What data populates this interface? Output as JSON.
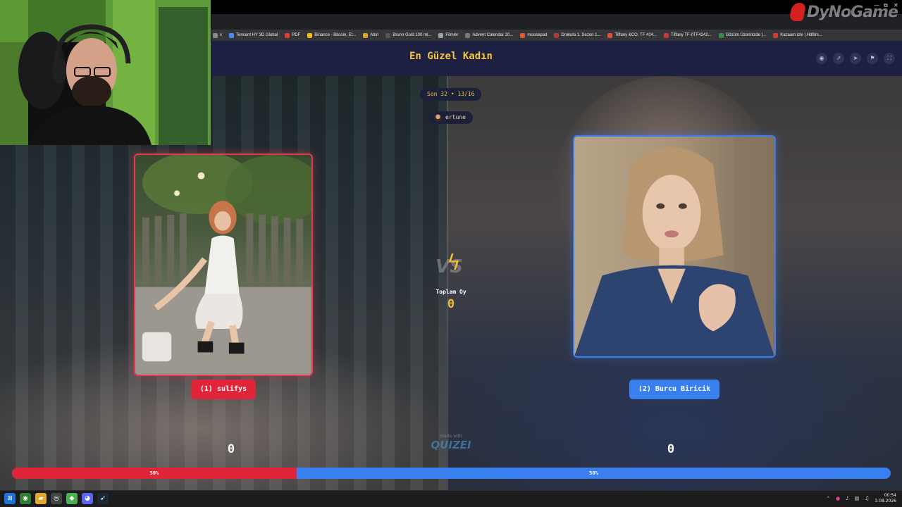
{
  "browser": {
    "bookmarks": [
      {
        "label": "x",
        "color": "#888888"
      },
      {
        "label": "Tencent HY 3D Global",
        "color": "#4a8cf0"
      },
      {
        "label": "PDF",
        "color": "#e03a3a"
      },
      {
        "label": "Binance - Bitcoin, Et...",
        "color": "#f0b90b"
      },
      {
        "label": "Altın",
        "color": "#d8a030"
      },
      {
        "label": "Bruno Gold 100 ml...",
        "color": "#555555"
      },
      {
        "label": "Filmler",
        "color": "#9aa0a6"
      },
      {
        "label": "Advent Calendar 20...",
        "color": "#7a7a7a"
      },
      {
        "label": "mousepad",
        "color": "#e05a2a"
      },
      {
        "label": "Drakula 1. Sezon 1...",
        "color": "#b03a3a"
      },
      {
        "label": "Tiffany &CO. TF 424...",
        "color": "#e05030"
      },
      {
        "label": "Tiffany TF-0TF4242...",
        "color": "#c03a3a"
      },
      {
        "label": "Gözüm Üzerinizde |...",
        "color": "#3a8a4a"
      },
      {
        "label": "Kazaam izle | Hdfilm...",
        "color": "#d04030"
      }
    ],
    "window_controls": [
      "—",
      "⧉",
      "✕"
    ]
  },
  "watermark": {
    "text": "DyNoGame"
  },
  "quiz": {
    "title": "En Güzel Kadın",
    "round": "Son 32 • 13/16",
    "username": "ertune",
    "header_icons": [
      "eye-icon",
      "share-icon",
      "send-icon",
      "flag-icon",
      "fullscreen-icon"
    ],
    "header_icon_glyphs": [
      "◉",
      "⇗",
      "➤",
      "⚑",
      "⛶"
    ],
    "vs_text": "VS",
    "total_votes_label": "Toplam Oy",
    "total_votes": "0",
    "made_with_small": "made with",
    "made_with_logo": "QUIZEI",
    "contestants": [
      {
        "label": "(1) sulifys",
        "votes": "0",
        "percent_label": "50%",
        "color": "#e0243a"
      },
      {
        "label": "(2) Burcu Biricik",
        "votes": "0",
        "percent_label": "50%",
        "color": "#3a7ff0"
      }
    ],
    "left_share": 0.5
  },
  "taskbar": {
    "apps": [
      {
        "name": "windows-start-icon",
        "glyph": "⊞",
        "color": "#1f6fd6"
      },
      {
        "name": "chrome-icon",
        "glyph": "◉",
        "color": "#2e7d32"
      },
      {
        "name": "file-explorer-icon",
        "glyph": "▰",
        "color": "#e0a82e"
      },
      {
        "name": "obs-icon",
        "glyph": "◎",
        "color": "#444444"
      },
      {
        "name": "android-studio-icon",
        "glyph": "◆",
        "color": "#4caf50"
      },
      {
        "name": "discord-icon",
        "glyph": "◕",
        "color": "#5865f2"
      },
      {
        "name": "steam-icon",
        "glyph": "➹",
        "color": "#1b2838"
      }
    ],
    "time": "00:54",
    "date": "3.08.2026"
  }
}
